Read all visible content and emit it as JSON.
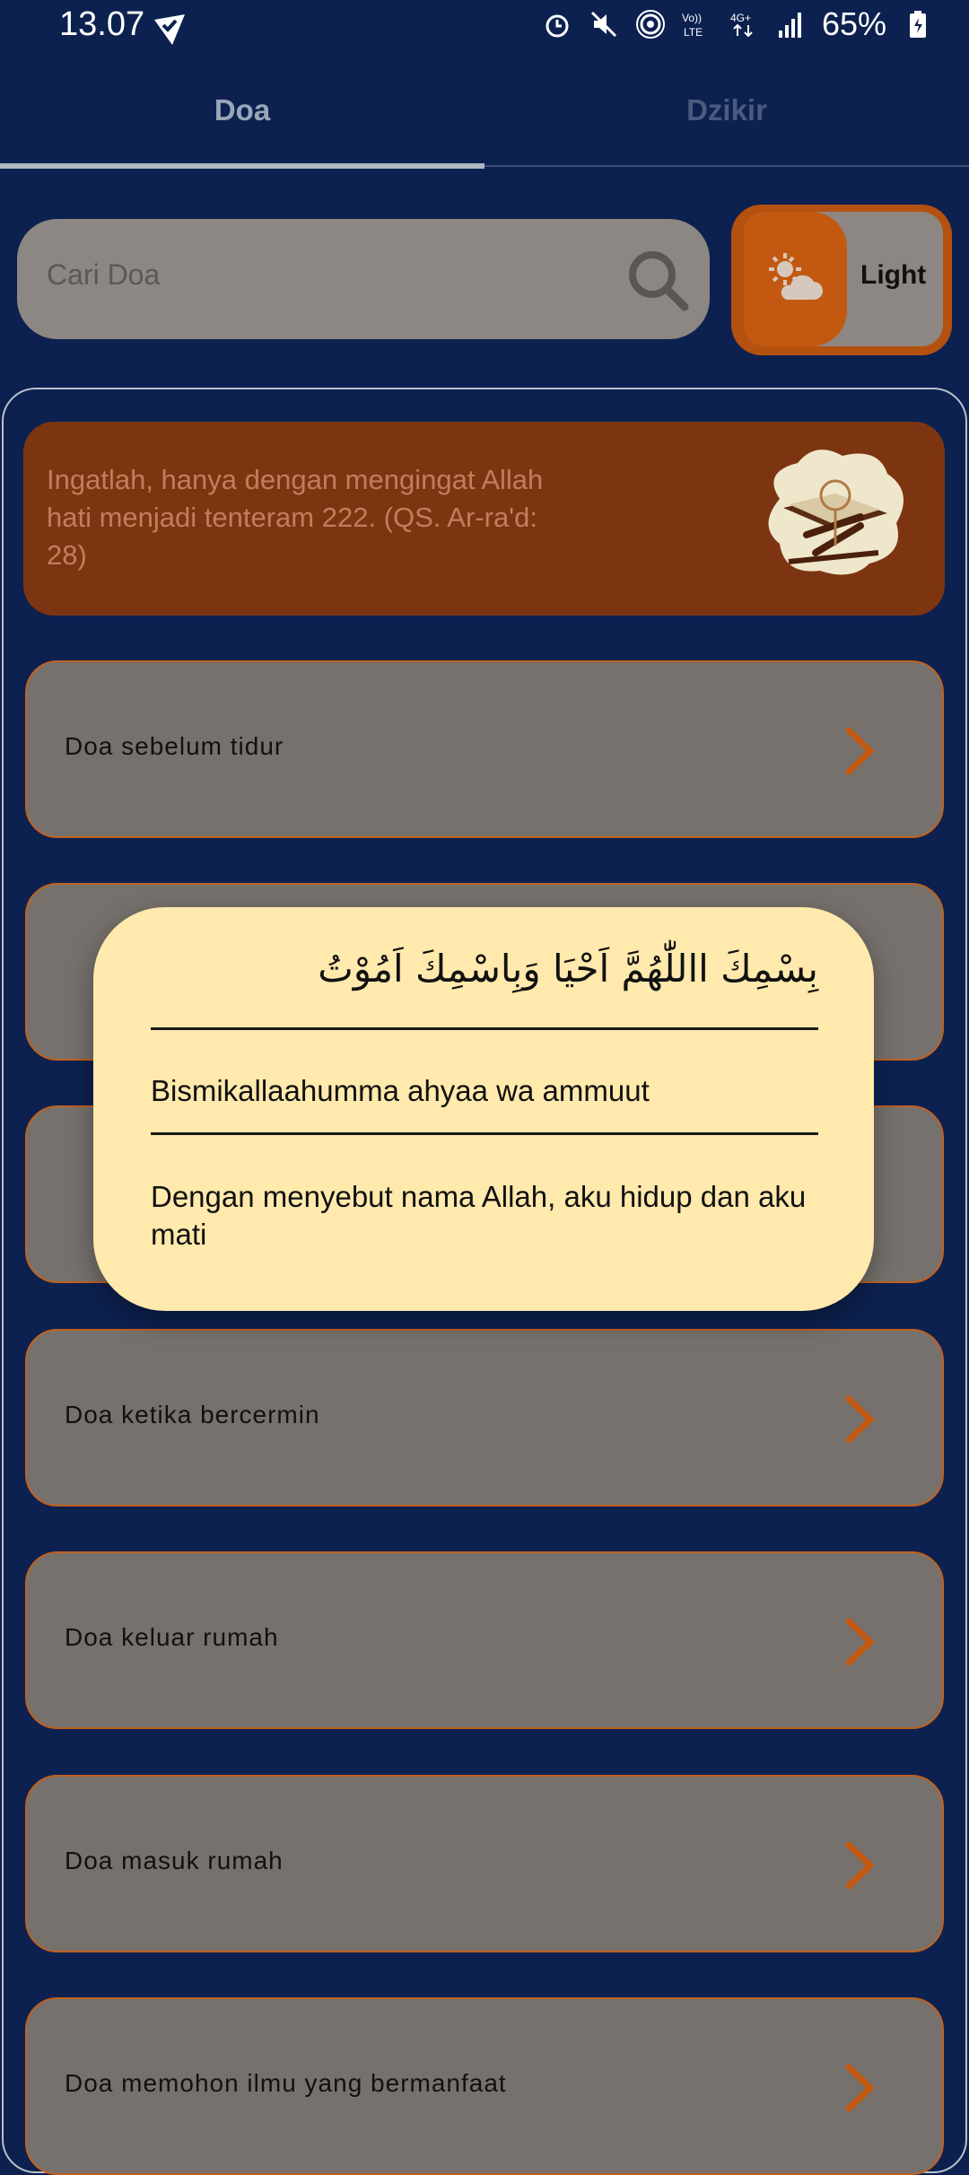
{
  "status_bar": {
    "time": "13.07",
    "battery": "65%"
  },
  "tabs": [
    {
      "label": "Doa",
      "selected": true
    },
    {
      "label": "Dzikir",
      "selected": false
    }
  ],
  "search": {
    "placeholder": "Cari Doa"
  },
  "theme_toggle": {
    "label": "Light"
  },
  "banner": {
    "text": "Ingatlah, hanya dengan mengingat Allah hati menjadi tenteram 222. (QS. Ar-ra'd: 28)"
  },
  "doa_list": [
    {
      "label": "Doa sebelum tidur"
    },
    {
      "label": ""
    },
    {
      "label": ""
    },
    {
      "label": "Doa ketika bercermin"
    },
    {
      "label": "Doa keluar rumah"
    },
    {
      "label": "Doa masuk rumah"
    },
    {
      "label": "Doa memohon ilmu yang bermanfaat"
    }
  ],
  "dialog": {
    "arabic": "بِسْمِكَ االلّٰهُمَّ اَحْيَا وَبِاسْمِكَ اَمُوْتُ",
    "latin": "Bismikallaahumma ahyaa wa ammuut",
    "meaning": "Dengan menyebut nama Allah, aku hidup dan aku mati"
  },
  "colors": {
    "background": "#0d2150",
    "accent_orange": "#c35810",
    "card": "#76716c",
    "dialog": "#ffe9ac"
  }
}
